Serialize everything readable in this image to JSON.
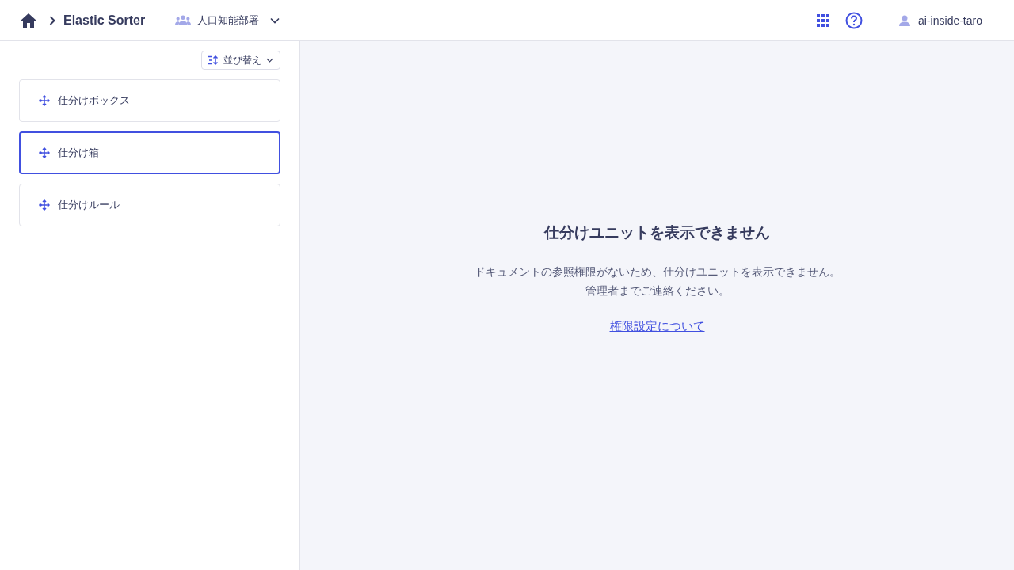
{
  "header": {
    "app_title": "Elastic Sorter",
    "department": "人口知能部署",
    "user": "ai-inside-taro"
  },
  "sidebar": {
    "sort_button": "並び替え",
    "items": [
      {
        "label": "仕分けボックス",
        "selected": false
      },
      {
        "label": "仕分け箱",
        "selected": true
      },
      {
        "label": "仕分けルール",
        "selected": false
      }
    ]
  },
  "message": {
    "title": "仕分けユニットを表示できません",
    "lines": [
      "ドキュメントの参照権限がないため、仕分けユニットを表示できません。",
      "管理者までご連絡ください。"
    ],
    "link": "権限設定について"
  }
}
